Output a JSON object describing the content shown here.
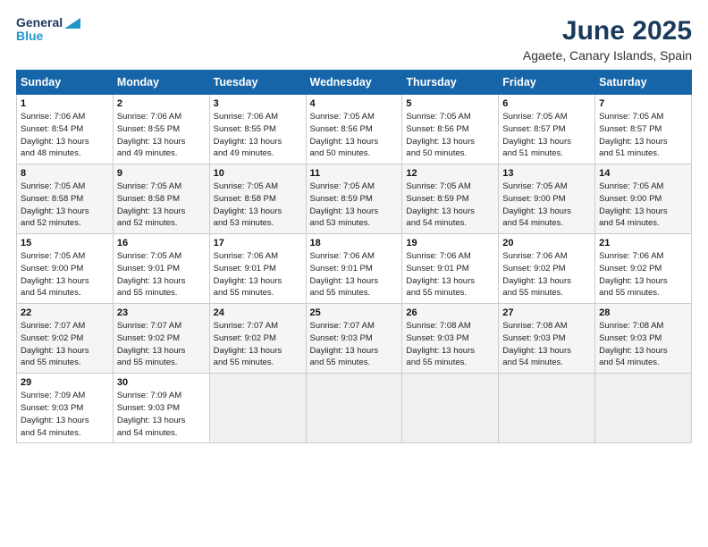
{
  "logo": {
    "line1": "General",
    "line2": "Blue"
  },
  "title": "June 2025",
  "subtitle": "Agaete, Canary Islands, Spain",
  "days_header": [
    "Sunday",
    "Monday",
    "Tuesday",
    "Wednesday",
    "Thursday",
    "Friday",
    "Saturday"
  ],
  "weeks": [
    [
      {
        "day": "1",
        "info": "Sunrise: 7:06 AM\nSunset: 8:54 PM\nDaylight: 13 hours\nand 48 minutes."
      },
      {
        "day": "2",
        "info": "Sunrise: 7:06 AM\nSunset: 8:55 PM\nDaylight: 13 hours\nand 49 minutes."
      },
      {
        "day": "3",
        "info": "Sunrise: 7:06 AM\nSunset: 8:55 PM\nDaylight: 13 hours\nand 49 minutes."
      },
      {
        "day": "4",
        "info": "Sunrise: 7:05 AM\nSunset: 8:56 PM\nDaylight: 13 hours\nand 50 minutes."
      },
      {
        "day": "5",
        "info": "Sunrise: 7:05 AM\nSunset: 8:56 PM\nDaylight: 13 hours\nand 50 minutes."
      },
      {
        "day": "6",
        "info": "Sunrise: 7:05 AM\nSunset: 8:57 PM\nDaylight: 13 hours\nand 51 minutes."
      },
      {
        "day": "7",
        "info": "Sunrise: 7:05 AM\nSunset: 8:57 PM\nDaylight: 13 hours\nand 51 minutes."
      }
    ],
    [
      {
        "day": "8",
        "info": "Sunrise: 7:05 AM\nSunset: 8:58 PM\nDaylight: 13 hours\nand 52 minutes."
      },
      {
        "day": "9",
        "info": "Sunrise: 7:05 AM\nSunset: 8:58 PM\nDaylight: 13 hours\nand 52 minutes."
      },
      {
        "day": "10",
        "info": "Sunrise: 7:05 AM\nSunset: 8:58 PM\nDaylight: 13 hours\nand 53 minutes."
      },
      {
        "day": "11",
        "info": "Sunrise: 7:05 AM\nSunset: 8:59 PM\nDaylight: 13 hours\nand 53 minutes."
      },
      {
        "day": "12",
        "info": "Sunrise: 7:05 AM\nSunset: 8:59 PM\nDaylight: 13 hours\nand 54 minutes."
      },
      {
        "day": "13",
        "info": "Sunrise: 7:05 AM\nSunset: 9:00 PM\nDaylight: 13 hours\nand 54 minutes."
      },
      {
        "day": "14",
        "info": "Sunrise: 7:05 AM\nSunset: 9:00 PM\nDaylight: 13 hours\nand 54 minutes."
      }
    ],
    [
      {
        "day": "15",
        "info": "Sunrise: 7:05 AM\nSunset: 9:00 PM\nDaylight: 13 hours\nand 54 minutes."
      },
      {
        "day": "16",
        "info": "Sunrise: 7:05 AM\nSunset: 9:01 PM\nDaylight: 13 hours\nand 55 minutes."
      },
      {
        "day": "17",
        "info": "Sunrise: 7:06 AM\nSunset: 9:01 PM\nDaylight: 13 hours\nand 55 minutes."
      },
      {
        "day": "18",
        "info": "Sunrise: 7:06 AM\nSunset: 9:01 PM\nDaylight: 13 hours\nand 55 minutes."
      },
      {
        "day": "19",
        "info": "Sunrise: 7:06 AM\nSunset: 9:01 PM\nDaylight: 13 hours\nand 55 minutes."
      },
      {
        "day": "20",
        "info": "Sunrise: 7:06 AM\nSunset: 9:02 PM\nDaylight: 13 hours\nand 55 minutes."
      },
      {
        "day": "21",
        "info": "Sunrise: 7:06 AM\nSunset: 9:02 PM\nDaylight: 13 hours\nand 55 minutes."
      }
    ],
    [
      {
        "day": "22",
        "info": "Sunrise: 7:07 AM\nSunset: 9:02 PM\nDaylight: 13 hours\nand 55 minutes."
      },
      {
        "day": "23",
        "info": "Sunrise: 7:07 AM\nSunset: 9:02 PM\nDaylight: 13 hours\nand 55 minutes."
      },
      {
        "day": "24",
        "info": "Sunrise: 7:07 AM\nSunset: 9:02 PM\nDaylight: 13 hours\nand 55 minutes."
      },
      {
        "day": "25",
        "info": "Sunrise: 7:07 AM\nSunset: 9:03 PM\nDaylight: 13 hours\nand 55 minutes."
      },
      {
        "day": "26",
        "info": "Sunrise: 7:08 AM\nSunset: 9:03 PM\nDaylight: 13 hours\nand 55 minutes."
      },
      {
        "day": "27",
        "info": "Sunrise: 7:08 AM\nSunset: 9:03 PM\nDaylight: 13 hours\nand 54 minutes."
      },
      {
        "day": "28",
        "info": "Sunrise: 7:08 AM\nSunset: 9:03 PM\nDaylight: 13 hours\nand 54 minutes."
      }
    ],
    [
      {
        "day": "29",
        "info": "Sunrise: 7:09 AM\nSunset: 9:03 PM\nDaylight: 13 hours\nand 54 minutes."
      },
      {
        "day": "30",
        "info": "Sunrise: 7:09 AM\nSunset: 9:03 PM\nDaylight: 13 hours\nand 54 minutes."
      },
      {
        "day": "",
        "info": ""
      },
      {
        "day": "",
        "info": ""
      },
      {
        "day": "",
        "info": ""
      },
      {
        "day": "",
        "info": ""
      },
      {
        "day": "",
        "info": ""
      }
    ]
  ]
}
